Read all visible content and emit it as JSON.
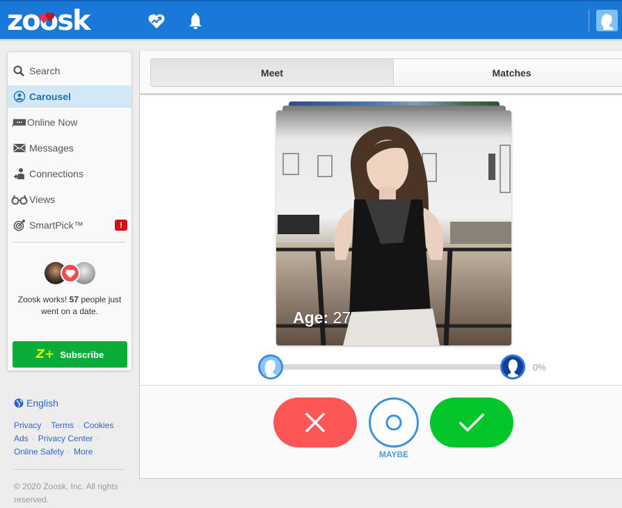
{
  "header": {
    "logo_text": "zoosk",
    "icons": [
      "heart-pulse-icon",
      "bell-icon",
      "user-avatar-icon"
    ],
    "brand_color": "#1a78d9"
  },
  "sidebar": {
    "items": [
      {
        "label": "Search",
        "icon": "search-icon",
        "active": false
      },
      {
        "label": "Carousel",
        "icon": "carousel-icon",
        "active": true
      },
      {
        "label": "Online Now",
        "icon": "chat-bubble-icon",
        "active": false
      },
      {
        "label": "Messages",
        "icon": "envelope-icon",
        "active": false
      },
      {
        "label": "Connections",
        "icon": "add-person-icon",
        "active": false
      },
      {
        "label": "Views",
        "icon": "glasses-icon",
        "active": false
      },
      {
        "label": "SmartPick™",
        "icon": "target-icon",
        "active": false,
        "badge": "!"
      }
    ],
    "dates_promo": {
      "prefix": "Zoosk works! ",
      "count": "57",
      "suffix": " people just went on a date."
    },
    "subscribe": {
      "badge": "Z+",
      "label": "Subscribe"
    }
  },
  "footer": {
    "language": "English",
    "links": [
      "Privacy",
      "Terms",
      "Cookies",
      "Ads",
      "Privacy Center",
      "Online Safety",
      "More"
    ],
    "copyright": "© 2020 Zoosk, Inc. All rights reserved."
  },
  "main": {
    "tabs": [
      {
        "label": "Meet",
        "active": true
      },
      {
        "label": "Matches",
        "active": false
      }
    ],
    "card": {
      "age_label": "Age:",
      "age_value": "27"
    },
    "compatibility": {
      "value_percent": 0,
      "label": "0%"
    },
    "actions": {
      "no_icon": "x-icon",
      "maybe_label": "MAYBE",
      "yes_icon": "check-icon"
    }
  }
}
